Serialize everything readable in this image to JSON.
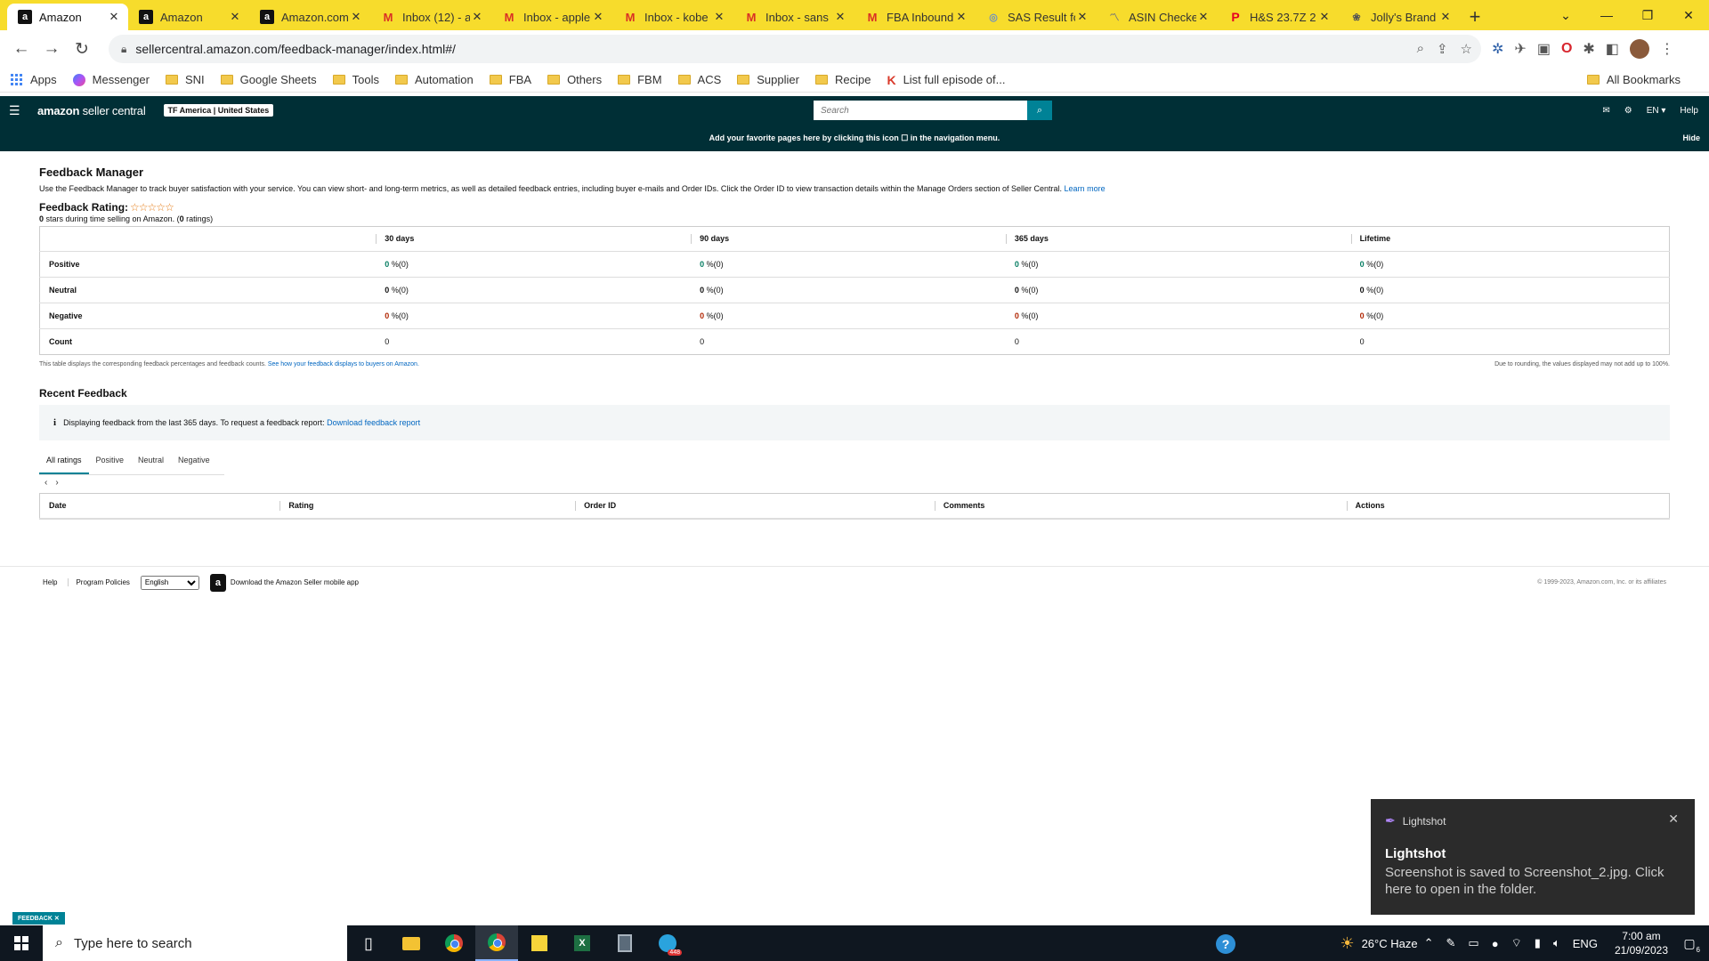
{
  "browser": {
    "tabs": [
      {
        "title": "Amazon",
        "favicon": "amazon-a",
        "active": true
      },
      {
        "title": "Amazon",
        "favicon": "amazon-a"
      },
      {
        "title": "Amazon.com",
        "favicon": "amazon-a-small"
      },
      {
        "title": "Inbox (12) - a",
        "favicon": "gmail-m"
      },
      {
        "title": "Inbox - apple",
        "favicon": "gmail-m"
      },
      {
        "title": "Inbox - kobe",
        "favicon": "gmail-m"
      },
      {
        "title": "Inbox - sans",
        "favicon": "gmail-m"
      },
      {
        "title": "FBA Inbound",
        "favicon": "gmail-m"
      },
      {
        "title": "SAS Result fo",
        "favicon": "globe"
      },
      {
        "title": "ASIN Checke",
        "favicon": "asin-checker"
      },
      {
        "title": "H&S 23.7Z 2",
        "favicon": "pinterest-p"
      },
      {
        "title": "Jolly's Brand",
        "favicon": "jolly"
      }
    ],
    "url": "sellercentral.amazon.com/feedback-manager/index.html#/",
    "bookmarks": [
      {
        "label": "Apps",
        "type": "apps"
      },
      {
        "label": "Messenger",
        "type": "messenger"
      },
      {
        "label": "SNI",
        "type": "folder"
      },
      {
        "label": "Google Sheets",
        "type": "folder"
      },
      {
        "label": "Tools",
        "type": "folder"
      },
      {
        "label": "Automation",
        "type": "folder"
      },
      {
        "label": "FBA",
        "type": "folder"
      },
      {
        "label": "Others",
        "type": "folder"
      },
      {
        "label": "FBM",
        "type": "folder"
      },
      {
        "label": "ACS",
        "type": "folder"
      },
      {
        "label": "Supplier",
        "type": "folder"
      },
      {
        "label": "Recipe",
        "type": "folder"
      },
      {
        "label": "List full episode of...",
        "type": "k-link"
      }
    ],
    "all_bookmarks": "All Bookmarks"
  },
  "header": {
    "logo_main": "amazon",
    "logo_sub": " seller central",
    "store": "TF America | United States",
    "search_placeholder": "Search",
    "lang": "EN ▾",
    "help": "Help",
    "favorites_message": "Add your favorite pages here by clicking this icon ☐ in the navigation menu.",
    "hide": "Hide"
  },
  "page": {
    "title": "Feedback Manager",
    "description": "Use the Feedback Manager to track buyer satisfaction with your service. You can view short- and long-term metrics, as well as detailed feedback entries, including buyer e-mails and Order IDs. Click the Order ID to view transaction details within the Manage Orders section of Seller Central.",
    "learn_more": "Learn more",
    "rating_label": "Feedback Rating:",
    "stars": "☆☆☆☆☆",
    "rating_stars_value": "0",
    "rating_mid": " stars during time selling on Amazon. (",
    "rating_count": "0",
    "rating_end": " ratings)",
    "metrics": {
      "columns": [
        "30 days",
        "90 days",
        "365 days",
        "Lifetime"
      ],
      "rows": [
        {
          "label": "Positive",
          "kind": "pos",
          "values": [
            [
              "0",
              " %(0)"
            ],
            [
              "0",
              " %(0)"
            ],
            [
              "0",
              " %(0)"
            ],
            [
              "0",
              " %(0)"
            ]
          ]
        },
        {
          "label": "Neutral",
          "kind": "neu",
          "values": [
            [
              "0",
              " %(0)"
            ],
            [
              "0",
              " %(0)"
            ],
            [
              "0",
              " %(0)"
            ],
            [
              "0",
              " %(0)"
            ]
          ]
        },
        {
          "label": "Negative",
          "kind": "neg",
          "values": [
            [
              "0",
              " %(0)"
            ],
            [
              "0",
              " %(0)"
            ],
            [
              "0",
              " %(0)"
            ],
            [
              "0",
              " %(0)"
            ]
          ]
        },
        {
          "label": "Count",
          "kind": "count",
          "values": [
            [
              "",
              "0"
            ],
            [
              "",
              "0"
            ],
            [
              "",
              "0"
            ],
            [
              "",
              "0"
            ]
          ]
        }
      ]
    },
    "table_note_left": "This table displays the corresponding feedback percentages and feedback counts.",
    "table_note_link": "See how your feedback displays to buyers on Amazon.",
    "table_note_right": "Due to rounding, the values displayed may not add up to 100%.",
    "recent_title": "Recent Feedback",
    "info_text": "Displaying feedback from the last 365 days. To request a feedback report:",
    "info_link": "Download feedback report",
    "rating_tabs": [
      "All ratings",
      "Positive",
      "Neutral",
      "Negative"
    ],
    "pager_prev": "‹",
    "pager_next": "›",
    "feedback_columns": [
      "Date",
      "Rating",
      "Order ID",
      "Comments",
      "Actions"
    ]
  },
  "footer": {
    "help": "Help",
    "policies": "Program Policies",
    "language": "English",
    "mobile_app": "Download the Amazon Seller mobile app",
    "copyright": "© 1999-2023, Amazon.com, Inc. or its affiliates"
  },
  "toast": {
    "app": "Lightshot",
    "title": "Lightshot",
    "body": "Screenshot is saved to Screenshot_2.jpg. Click here to open in the folder."
  },
  "feedback_tab": "FEEDBACK ✕",
  "taskbar": {
    "search_placeholder": "Type here to search",
    "telegram_badge": "448",
    "weather": "26°C  Haze",
    "lang": "ENG",
    "time": "7:00 am",
    "date": "21/09/2023",
    "notifications": "6"
  }
}
